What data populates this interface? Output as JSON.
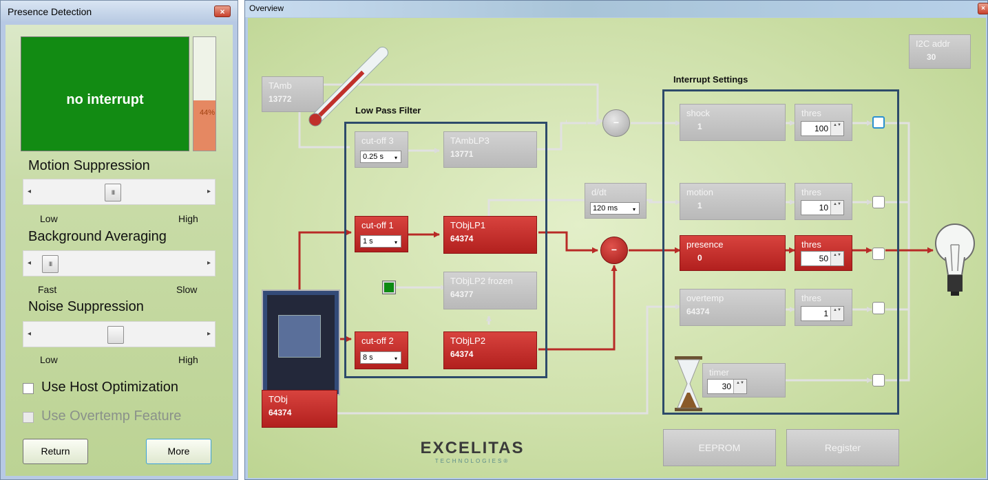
{
  "left_window": {
    "title": "Presence Detection",
    "close_glyph": "×",
    "status": {
      "text": "no interrupt",
      "color": "#128b13"
    },
    "level": {
      "percent": 44,
      "text": "44%"
    },
    "sections": [
      {
        "title": "Motion Suppression",
        "low": "Low",
        "high": "High",
        "thumb_glyph": "III"
      },
      {
        "title": "Background Averaging",
        "low": "Fast",
        "high": "Slow",
        "thumb_glyph": "III"
      },
      {
        "title": "Noise Suppression",
        "low": "Low",
        "high": "High",
        "thumb_glyph": ""
      }
    ],
    "arrow_left": "◂",
    "arrow_right": "▸",
    "checkboxes": [
      {
        "label": "Use Host Optimization",
        "checked": false,
        "enabled": true
      },
      {
        "label": "Use Overtemp Feature",
        "checked": false,
        "enabled": false
      }
    ],
    "buttons": {
      "return": "Return",
      "more": "More"
    }
  },
  "right_window": {
    "title": "Overview",
    "close_glyph": "×",
    "i2c": {
      "label": "I2C addr",
      "value": "30"
    },
    "tamb": {
      "label": "TAmb",
      "value": "13772"
    },
    "tobj": {
      "label": "TObj",
      "value": "64374"
    },
    "low_pass_filter": {
      "title": "Low Pass Filter",
      "cutoff3": {
        "label": "cut-off 3",
        "value": "0.25 s"
      },
      "tamblp3": {
        "label": "TAmbLP3",
        "value": "13771"
      },
      "cutoff1": {
        "label": "cut-off 1",
        "value": "1 s"
      },
      "tobjlp1": {
        "label": "TObjLP1",
        "value": "64374"
      },
      "tobjlp2_frozen": {
        "label": "TObjLP2 frozen",
        "value": "64377"
      },
      "cutoff2": {
        "label": "cut-off 2",
        "value": "8 s"
      },
      "tobjlp2": {
        "label": "TObjLP2",
        "value": "64374"
      }
    },
    "ddt": {
      "label": "d/dt",
      "value": "120 ms"
    },
    "subtract_glyph": "−",
    "dropdown_glyph": "▾",
    "spin_glyph": "▲▼",
    "interrupt_settings": {
      "title": "Interrupt Settings",
      "thres_label": "thres",
      "rows": [
        {
          "label": "shock",
          "value": "1",
          "thres": "100",
          "state": "idle"
        },
        {
          "label": "motion",
          "value": "1",
          "thres": "10",
          "state": "idle"
        },
        {
          "label": "presence",
          "value": "0",
          "thres": "50",
          "state": "active"
        },
        {
          "label": "overtemp",
          "value": "64374",
          "thres": "1",
          "state": "idle"
        }
      ],
      "timer": {
        "label": "timer",
        "value": "30"
      }
    },
    "buttons": {
      "eeprom": "EEPROM",
      "register": "Register"
    },
    "logo": {
      "main": "EXCELITAS",
      "sub": "TECHNOLOGIES®"
    },
    "colors": {
      "active_red": "#c52b27",
      "inactive_gray": "#c3c3c3",
      "group_border": "#2d4a6a"
    }
  }
}
